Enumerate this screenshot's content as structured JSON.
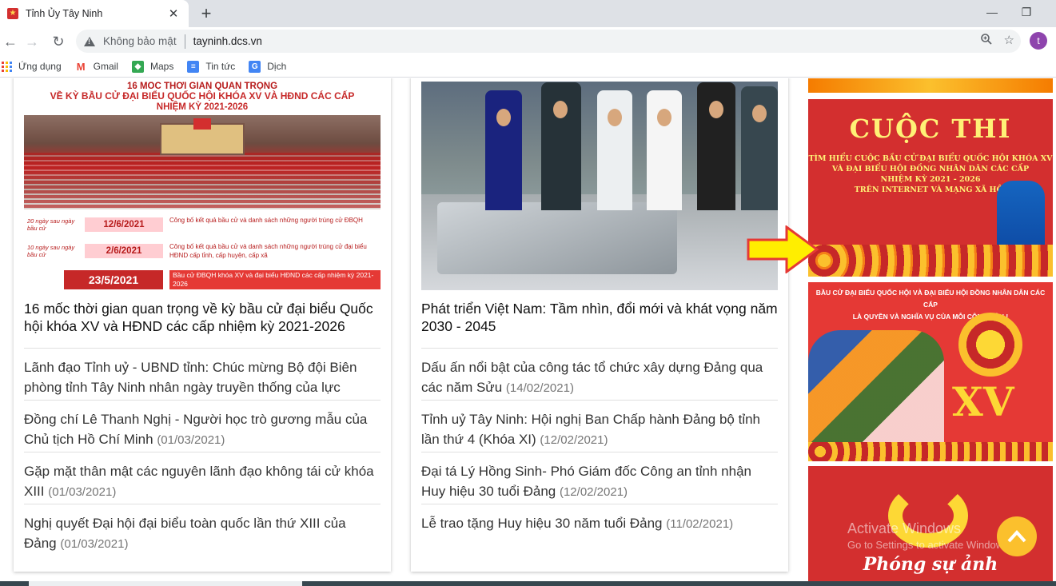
{
  "browser": {
    "tab_title": "Tỉnh Ủy Tây Ninh",
    "security_label": "Không bảo mật",
    "url": "tayninh.dcs.vn",
    "profile_initial": "t",
    "bookmarks": [
      {
        "label": "Ứng dụng",
        "icon": "apps-icon"
      },
      {
        "label": "Gmail",
        "icon": "gmail-icon"
      },
      {
        "label": "Maps",
        "icon": "maps-icon"
      },
      {
        "label": "Tin tức",
        "icon": "news-icon"
      },
      {
        "label": "Dịch",
        "icon": "translate-icon"
      }
    ]
  },
  "left_card": {
    "infographic": {
      "heading_1": "16 MỐC THỜI GIAN QUAN TRỌNG",
      "heading_2": "VỀ KỲ BẦU CỬ ĐẠI BIỂU QUỐC HỘI KHÓA XV VÀ HĐND CÁC CẤP",
      "heading_3": "NHIỆM KỲ 2021-2026",
      "rows": [
        {
          "note": "20 ngày sau ngày bầu cử",
          "date": "12/6/2021",
          "desc": "Công bố kết quả bầu cử và danh sách những người trúng cử ĐBQH"
        },
        {
          "note": "10 ngày sau ngày bầu cử",
          "date": "2/6/2021",
          "desc": "Công bố kết quả bầu cử và danh sách những người trúng cử đại biểu HĐND cấp tỉnh, cấp huyện, cấp xã"
        }
      ],
      "final_date": "23/5/2021",
      "final_desc": "Bầu cử ĐBQH khóa XV và đại biểu HĐND các cấp nhiệm kỳ 2021-2026"
    },
    "headline": "16 mốc thời gian quan trọng về kỳ bầu cử đại biểu Quốc hội khóa XV và HĐND các cấp nhiệm kỳ 2021-2026",
    "items": [
      {
        "title": "Lãnh đạo Tỉnh uỷ - UBND tỉnh: Chúc mừng Bộ đội Biên phòng tỉnh Tây Ninh nhân ngày truyền thống của lực",
        "date": ""
      },
      {
        "title": "Đồng chí Lê Thanh Nghị - Người học trò gương mẫu của Chủ tịch Hồ Chí Minh",
        "date": "(01/03/2021)"
      },
      {
        "title": "Gặp mặt thân mật các nguyên lãnh đạo không tái cử khóa XIII",
        "date": "(01/03/2021)"
      },
      {
        "title": "Nghị quyết Đại hội đại biểu toàn quốc lần thứ XIII của Đảng",
        "date": "(01/03/2021)"
      }
    ]
  },
  "right_card": {
    "headline": "Phát triển Việt Nam: Tầm nhìn, đổi mới và khát vọng năm 2030 - 2045",
    "items": [
      {
        "title": "Dấu ấn nổi bật của công tác tổ chức xây dựng Đảng qua các năm Sửu",
        "date": "(14/02/2021)"
      },
      {
        "title": "Tỉnh uỷ Tây Ninh: Hội nghị Ban Chấp hành Đảng bộ tỉnh lần thứ 4 (Khóa XI)",
        "date": "(12/02/2021)"
      },
      {
        "title": "Đại tá Lý Hồng Sinh- Phó Giám đốc Công an tỉnh nhận Huy hiệu 30 tuổi Đảng",
        "date": "(12/02/2021)"
      },
      {
        "title": "Lễ trao tặng Huy hiệu 30 năm tuổi Đảng",
        "date": "(11/02/2021)"
      }
    ]
  },
  "sidebar": {
    "banner1": {
      "title": "CUỘC THI",
      "subtitle_1": "TÌM HIỂU CUỘC BẦU CỬ ĐẠI BIỂU QUỐC HỘI KHÓA XV",
      "subtitle_2": "VÀ ĐẠI BIỂU HỘI ĐỒNG NHÂN DÂN CÁC CẤP",
      "subtitle_3": "NHIỆM KỲ 2021 - 2026",
      "subtitle_4": "TRÊN INTERNET VÀ MẠNG XÃ HỘI"
    },
    "banner2": {
      "title_1": "BẦU CỬ ĐẠI BIỂU QUỐC HỘI VÀ ĐẠI BIỂU HỘI ĐỒNG NHÂN DÂN CÁC CẤP",
      "title_2": "LÀ QUYỀN VÀ NGHĨA VỤ CỦA MỖI CÔNG DÂN !",
      "emblem_text": "XV"
    },
    "banner3": {
      "title": "Phóng sự ảnh"
    }
  },
  "watermark": {
    "line1": "Activate Windows",
    "line2": "Go to Settings to activate Windows."
  },
  "colors": {
    "brand_red": "#d32f2f",
    "accent_yellow": "#fbc02d"
  }
}
